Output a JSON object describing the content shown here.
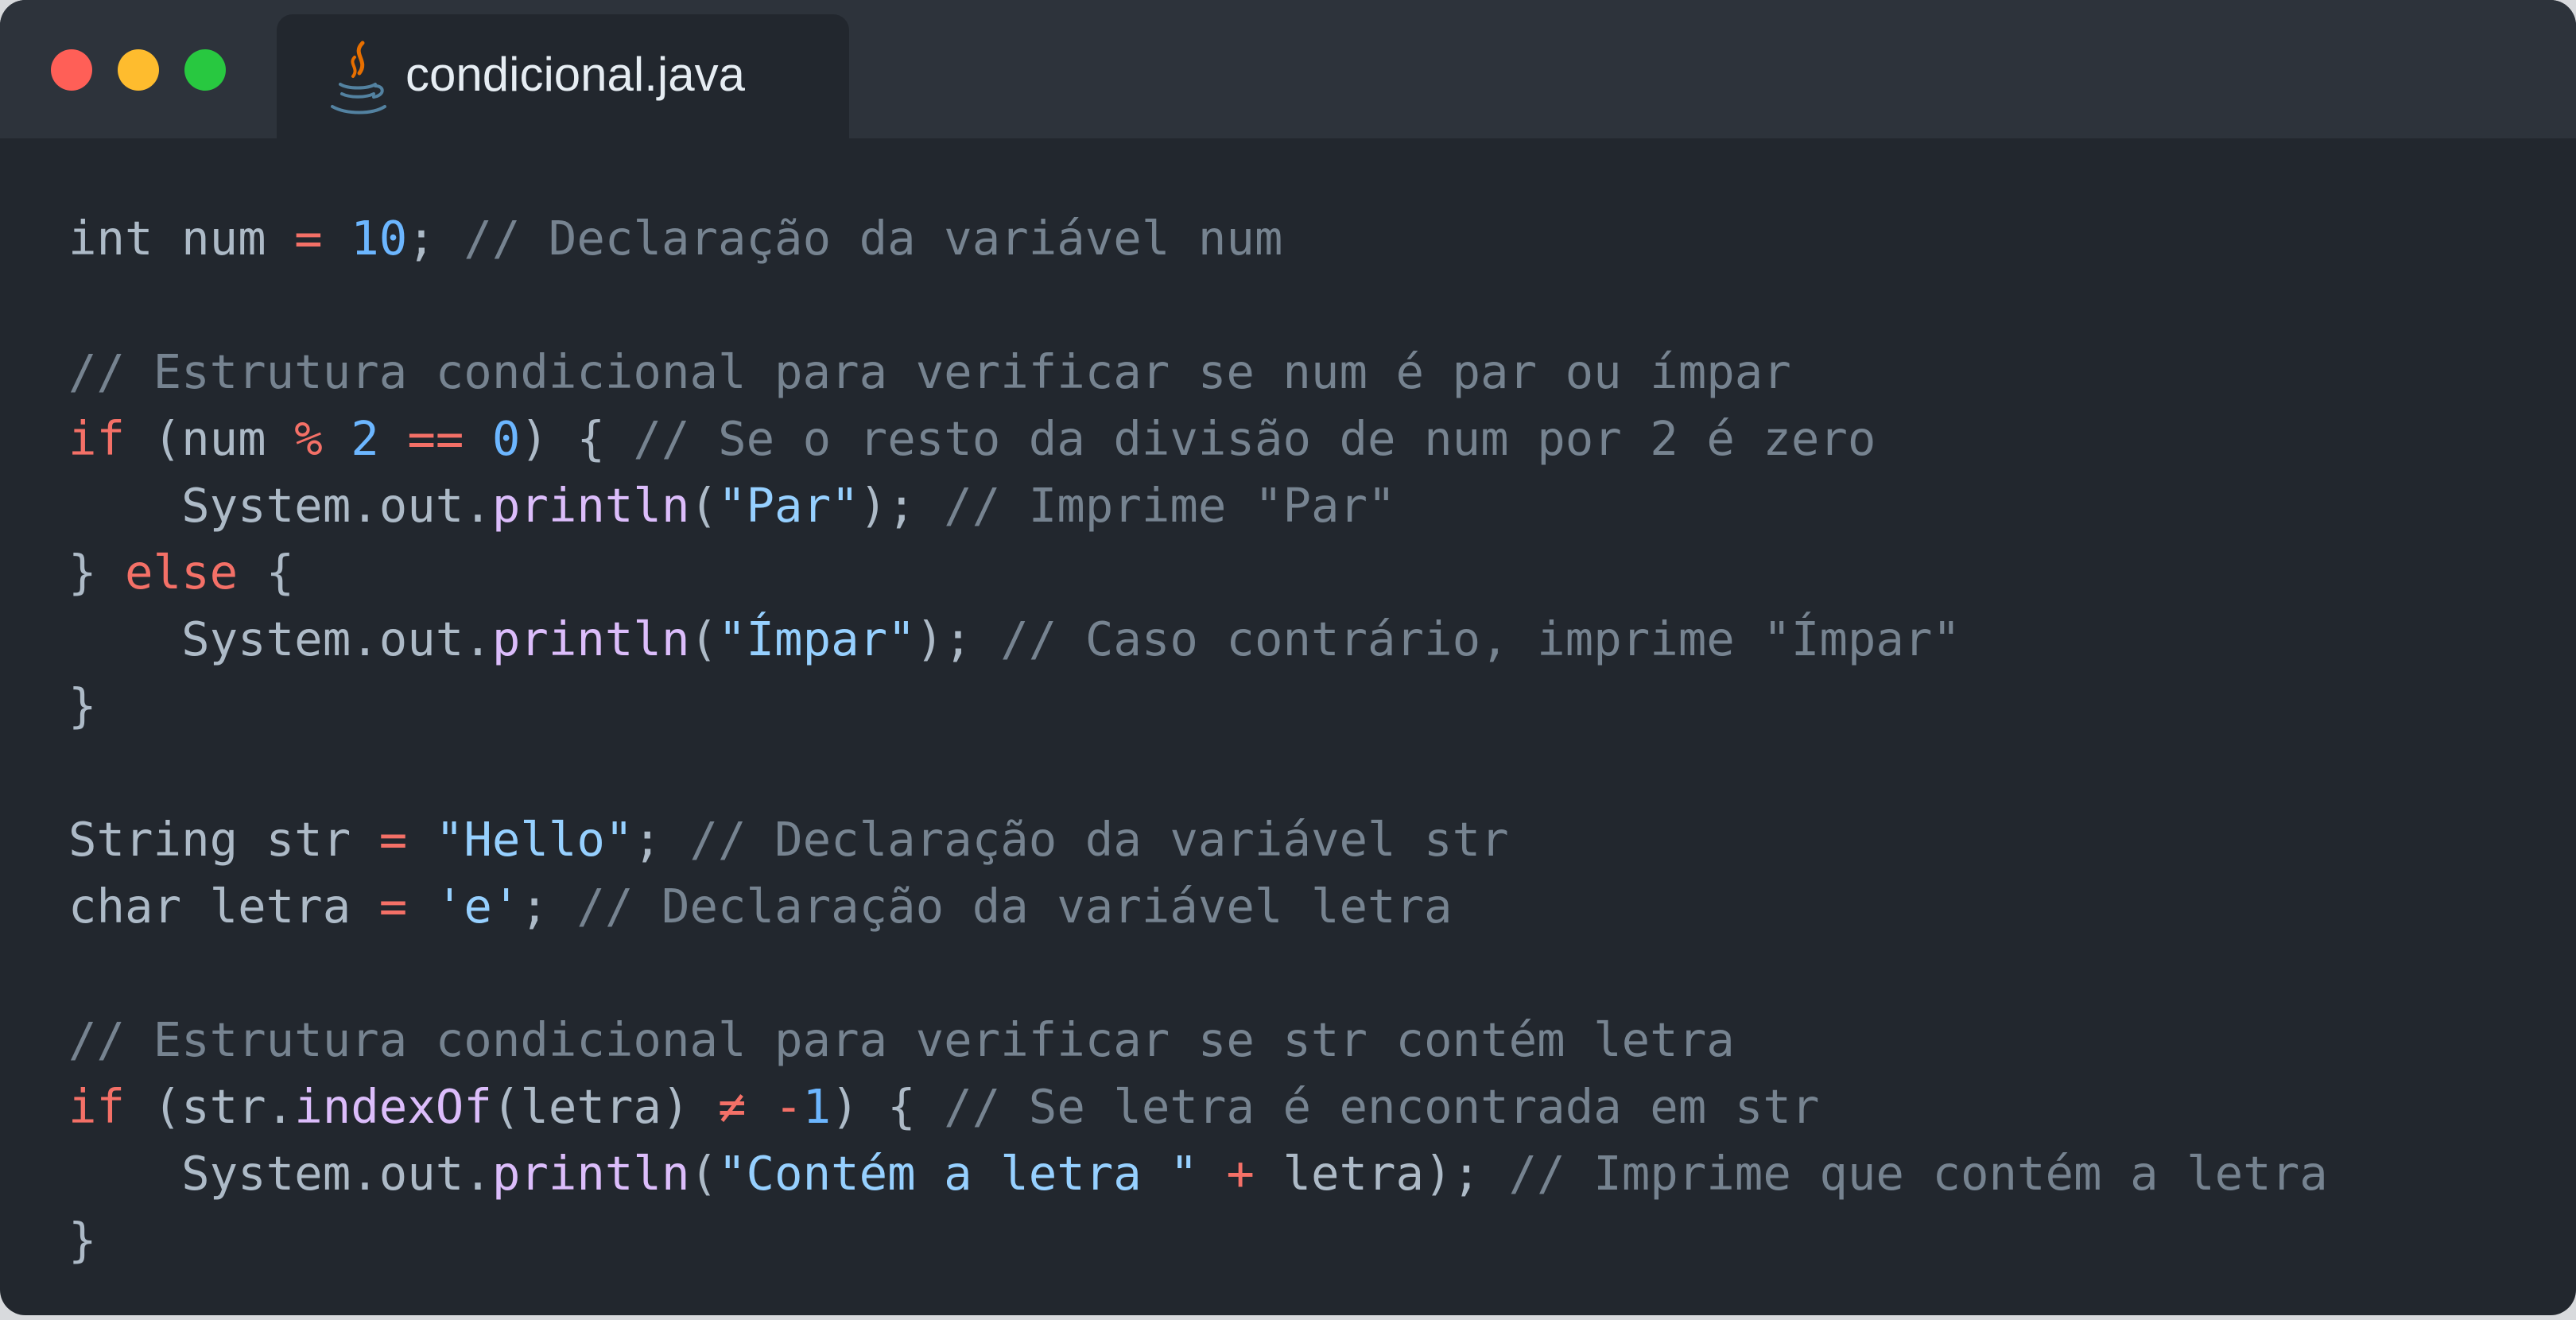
{
  "window": {
    "controls": [
      "close",
      "minimize",
      "maximize"
    ]
  },
  "tab": {
    "title": "condicional.java",
    "icon": "java-icon"
  },
  "colors": {
    "background": "#22272e",
    "titlebar": "#2d333b",
    "keyword": "#f47067",
    "number": "#6cb6ff",
    "string": "#96d0ff",
    "function": "#dcbdfb",
    "comment": "#768390",
    "plain": "#adbac7"
  },
  "code": {
    "language": "java",
    "lines": [
      [
        {
          "t": "plain",
          "v": "int num "
        },
        {
          "t": "operator",
          "v": "="
        },
        {
          "t": "plain",
          "v": " "
        },
        {
          "t": "number",
          "v": "10"
        },
        {
          "t": "plain",
          "v": "; "
        },
        {
          "t": "comment",
          "v": "// Declaração da variável num"
        }
      ],
      [],
      [
        {
          "t": "comment",
          "v": "// Estrutura condicional para verificar se num é par ou ímpar"
        }
      ],
      [
        {
          "t": "keyword",
          "v": "if"
        },
        {
          "t": "plain",
          "v": " (num "
        },
        {
          "t": "operator",
          "v": "%"
        },
        {
          "t": "plain",
          "v": " "
        },
        {
          "t": "number",
          "v": "2"
        },
        {
          "t": "plain",
          "v": " "
        },
        {
          "t": "operator",
          "v": "=="
        },
        {
          "t": "plain",
          "v": " "
        },
        {
          "t": "number",
          "v": "0"
        },
        {
          "t": "plain",
          "v": ") { "
        },
        {
          "t": "comment",
          "v": "// Se o resto da divisão de num por 2 é zero"
        }
      ],
      [
        {
          "t": "plain",
          "v": "    System.out."
        },
        {
          "t": "function",
          "v": "println"
        },
        {
          "t": "plain",
          "v": "("
        },
        {
          "t": "string",
          "v": "\"Par\""
        },
        {
          "t": "plain",
          "v": "); "
        },
        {
          "t": "comment",
          "v": "// Imprime \"Par\""
        }
      ],
      [
        {
          "t": "plain",
          "v": "} "
        },
        {
          "t": "keyword",
          "v": "else"
        },
        {
          "t": "plain",
          "v": " {"
        }
      ],
      [
        {
          "t": "plain",
          "v": "    System.out."
        },
        {
          "t": "function",
          "v": "println"
        },
        {
          "t": "plain",
          "v": "("
        },
        {
          "t": "string",
          "v": "\"Ímpar\""
        },
        {
          "t": "plain",
          "v": "); "
        },
        {
          "t": "comment",
          "v": "// Caso contrário, imprime \"Ímpar\""
        }
      ],
      [
        {
          "t": "plain",
          "v": "}"
        }
      ],
      [],
      [
        {
          "t": "plain",
          "v": "String str "
        },
        {
          "t": "operator",
          "v": "="
        },
        {
          "t": "plain",
          "v": " "
        },
        {
          "t": "string",
          "v": "\"Hello\""
        },
        {
          "t": "plain",
          "v": "; "
        },
        {
          "t": "comment",
          "v": "// Declaração da variável str"
        }
      ],
      [
        {
          "t": "plain",
          "v": "char letra "
        },
        {
          "t": "operator",
          "v": "="
        },
        {
          "t": "plain",
          "v": " "
        },
        {
          "t": "string",
          "v": "'e'"
        },
        {
          "t": "plain",
          "v": "; "
        },
        {
          "t": "comment",
          "v": "// Declaração da variável letra"
        }
      ],
      [],
      [
        {
          "t": "comment",
          "v": "// Estrutura condicional para verificar se str contém letra"
        }
      ],
      [
        {
          "t": "keyword",
          "v": "if"
        },
        {
          "t": "plain",
          "v": " (str."
        },
        {
          "t": "function",
          "v": "indexOf"
        },
        {
          "t": "plain",
          "v": "(letra) "
        },
        {
          "t": "operator",
          "v": "≠"
        },
        {
          "t": "plain",
          "v": " "
        },
        {
          "t": "operator",
          "v": "-"
        },
        {
          "t": "number",
          "v": "1"
        },
        {
          "t": "plain",
          "v": ") { "
        },
        {
          "t": "comment",
          "v": "// Se letra é encontrada em str"
        }
      ],
      [
        {
          "t": "plain",
          "v": "    System.out."
        },
        {
          "t": "function",
          "v": "println"
        },
        {
          "t": "plain",
          "v": "("
        },
        {
          "t": "string",
          "v": "\"Contém a letra \""
        },
        {
          "t": "plain",
          "v": " "
        },
        {
          "t": "operator",
          "v": "+"
        },
        {
          "t": "plain",
          "v": " letra); "
        },
        {
          "t": "comment",
          "v": "// Imprime que contém a letra"
        }
      ],
      [
        {
          "t": "plain",
          "v": "}"
        }
      ]
    ]
  }
}
